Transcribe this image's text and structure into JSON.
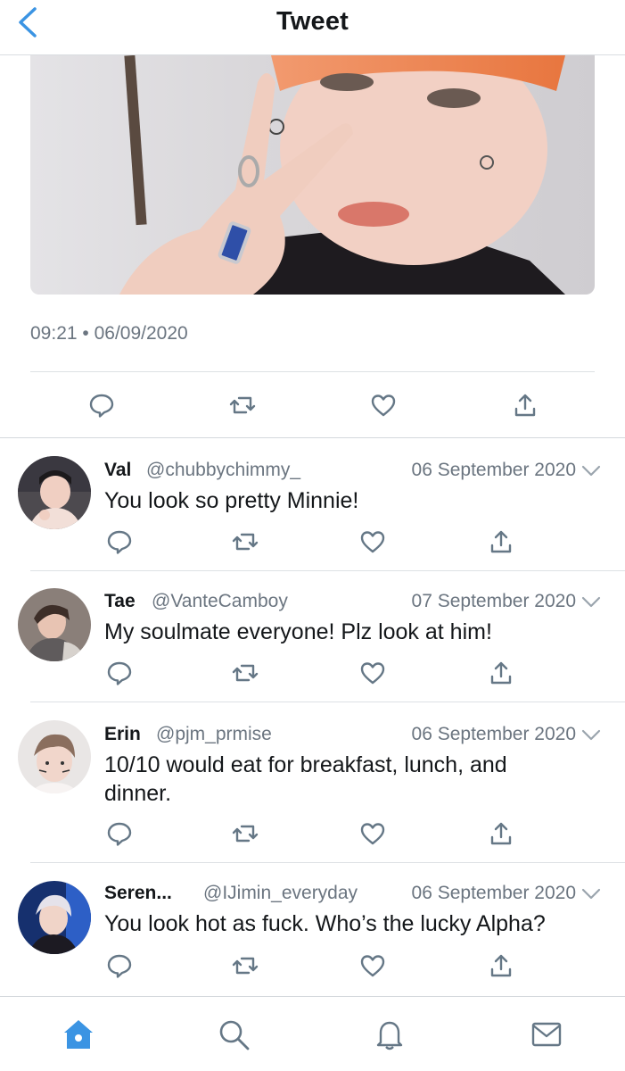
{
  "header": {
    "title": "Tweet"
  },
  "tweet": {
    "time": "09:21",
    "dot": "•",
    "date": "06/09/2020"
  },
  "replies": [
    {
      "name": "Val",
      "handle": "@chubbychimmy_",
      "date": "06 September 2020",
      "text": "You look so pretty Minnie!"
    },
    {
      "name": "Tae",
      "handle": "@VanteCamboy",
      "date": "07 September 2020",
      "text": "My soulmate everyone! Plz look at him!"
    },
    {
      "name": "Erin",
      "handle": "@pjm_prmise",
      "date": "06 September 2020",
      "text": "10/10 would eat for breakfast, lunch, and dinner."
    },
    {
      "name": "Seren...",
      "handle": "@IJimin_everyday",
      "date": "06 September 2020",
      "text": "You look hot as fuck. Who’s the lucky Alpha?"
    }
  ],
  "tabs": [
    "home-icon",
    "search-icon",
    "notifications-icon",
    "messages-icon"
  ],
  "colors": {
    "accent": "#3b94e3",
    "muted": "#6b7580",
    "icon": "#657786"
  }
}
